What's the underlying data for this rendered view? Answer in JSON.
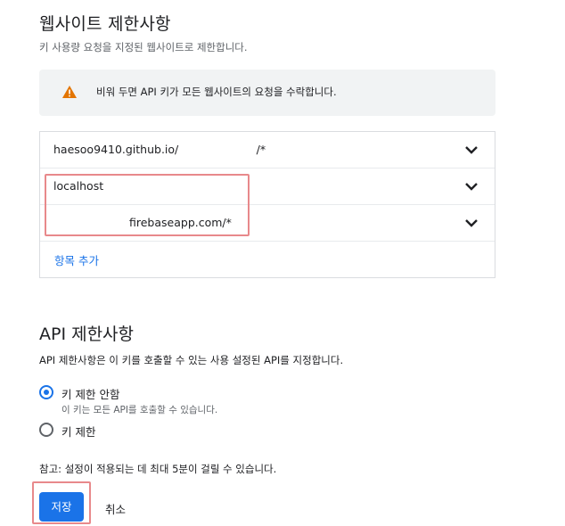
{
  "website_restrictions": {
    "title": "웹사이트 제한사항",
    "subtitle": "키 사용량 요청을 지정된 웹사이트로 제한합니다.",
    "warning": {
      "icon": "warning-icon",
      "text": "비워 두면 API 키가 모든 웹사이트의 요청을 수락합니다."
    },
    "items": [
      {
        "value": "haesoo9410.github.io/                      /*"
      },
      {
        "value": "localhost"
      },
      {
        "value": "firebaseapp.com/*"
      }
    ],
    "add_item_label": "항목 추가"
  },
  "api_restrictions": {
    "title": "API 제한사항",
    "description": "API 제한사항은 이 키를 호출할 수 있는 사용 설정된 API를 지정합니다.",
    "options": [
      {
        "label": "키 제한 안함",
        "hint": "이 키는 모든 API를 호출할 수 있습니다.",
        "selected": true
      },
      {
        "label": "키 제한",
        "selected": false
      }
    ]
  },
  "note": "참고: 설정이 적용되는 데 최대 5분이 걸릴 수 있습니다.",
  "actions": {
    "save_label": "저장",
    "cancel_label": "취소"
  },
  "colors": {
    "accent": "#1a73e8",
    "warning": "#e37400",
    "highlight": "#e8898b"
  }
}
